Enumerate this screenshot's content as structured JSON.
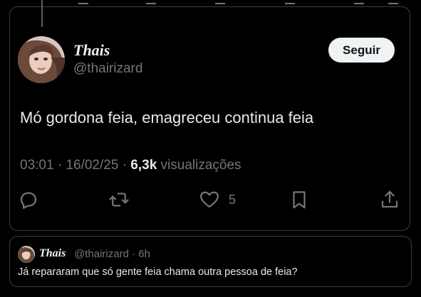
{
  "tweet": {
    "author": {
      "name": "Thais",
      "handle": "@thairizard"
    },
    "follow_label": "Seguir",
    "text": "Mó gordona feia, emagreceu continua feia",
    "time": "03:01",
    "sep1": " · ",
    "date": "16/02/25",
    "sep2": " · ",
    "views_count": "6,3k",
    "views_label": " visualizações",
    "actions": {
      "reply_icon": "reply-icon",
      "retweet_icon": "retweet-icon",
      "like_icon": "heart-icon",
      "likes": "5",
      "bookmark_icon": "bookmark-icon",
      "share_icon": "share-icon"
    }
  },
  "quote": {
    "author": {
      "name": "Thais",
      "handle": "@thairizard",
      "time": "6h"
    },
    "text": "Já repararam que só gente feia chama outra pessoa de feia?"
  },
  "colors": {
    "background": "#000000",
    "text": "#e7e9ea",
    "secondary": "#71767b",
    "border": "#3a3d41",
    "button_bg": "#eff3f4"
  }
}
